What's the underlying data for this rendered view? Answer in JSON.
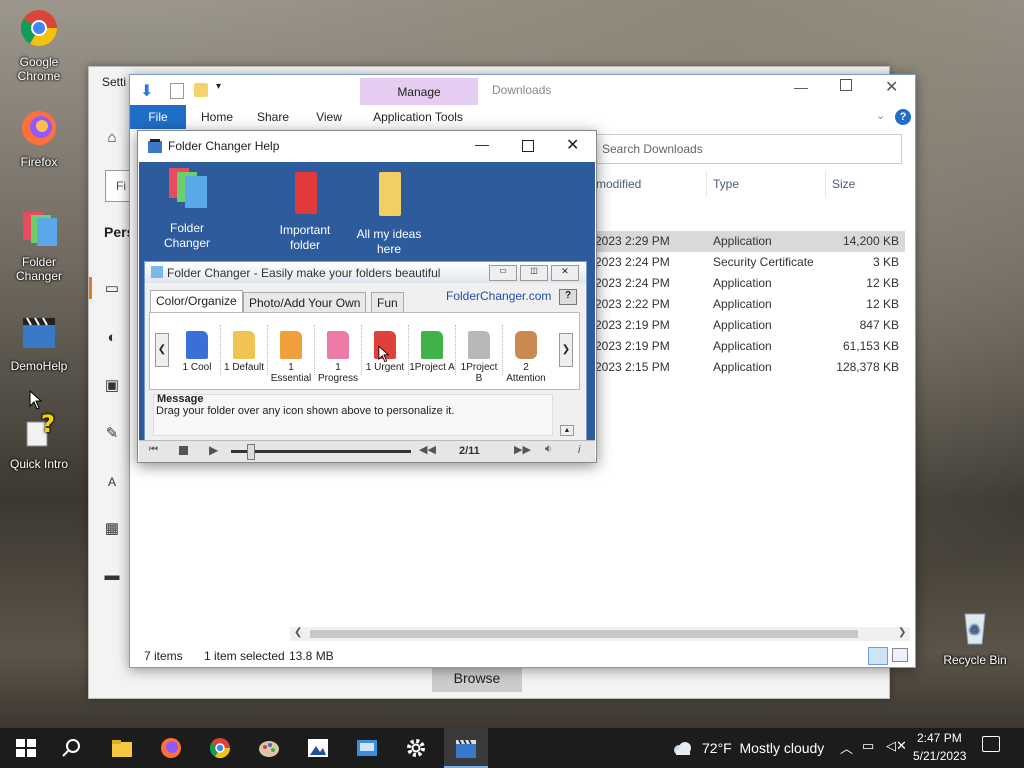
{
  "desktop": {
    "icons": [
      {
        "label": "Google Chrome"
      },
      {
        "label": "Firefox"
      },
      {
        "label": "Folder Changer"
      },
      {
        "label": "DemoHelp"
      },
      {
        "label": "Quick Intro"
      },
      {
        "label": "Recycle Bin"
      }
    ]
  },
  "settings": {
    "title": "Setti",
    "search_placeholder": "Fi",
    "section": "Pers",
    "browse_button": "Browse"
  },
  "explorer": {
    "title": "Downloads",
    "manage_tab": "Manage",
    "tabs": [
      "File",
      "Home",
      "Share",
      "View",
      "Application Tools"
    ],
    "search_placeholder": "Search Downloads",
    "columns": {
      "modified": "modified",
      "type": "Type",
      "size": "Size"
    },
    "files": [
      {
        "date": "2023 2:29 PM",
        "type": "Application",
        "size": "14,200 KB"
      },
      {
        "date": "2023 2:24 PM",
        "type": "Security Certificate",
        "size": "3 KB"
      },
      {
        "date": "2023 2:24 PM",
        "type": "Application",
        "size": "12 KB"
      },
      {
        "date": "2023 2:22 PM",
        "type": "Application",
        "size": "12 KB"
      },
      {
        "date": "2023 2:19 PM",
        "type": "Application",
        "size": "847 KB"
      },
      {
        "date": "2023 2:19 PM",
        "type": "Application",
        "size": "61,153 KB"
      },
      {
        "date": "2023 2:15 PM",
        "type": "Application",
        "size": "128,378 KB"
      }
    ],
    "status": {
      "items": "7 items",
      "selected": "1 item selected",
      "size": "13.8 MB"
    }
  },
  "help_window": {
    "title": "Folder Changer Help",
    "icons": [
      {
        "label": "Folder Changer"
      },
      {
        "label": "Important folder"
      },
      {
        "label": "All my ideas here"
      }
    ],
    "inner_title": "Folder Changer - Easily make your folders beautiful",
    "tabs": [
      "Color/Organize",
      "Photo/Add Your Own",
      "Fun"
    ],
    "link": "FolderChanger.com",
    "help_btn": "?",
    "folders": [
      {
        "label": "1 Cool",
        "color": "#3a6fd8"
      },
      {
        "label": "1 Default",
        "color": "#f0c452"
      },
      {
        "label": "1 Essential",
        "color": "#f0a03a"
      },
      {
        "label": "1 Progress",
        "color": "#ee7aa8"
      },
      {
        "label": "1 Urgent",
        "color": "#e0403a"
      },
      {
        "label": "1Project A",
        "color": "#3fb24a"
      },
      {
        "label": "1Project B",
        "color": "#b8b8b8"
      },
      {
        "label": "2 Attention",
        "color": "#c88a50"
      }
    ],
    "message_title": "Message",
    "message_text": "Drag your folder over any icon shown above to personalize it.",
    "player_counter": "2/11"
  },
  "taskbar": {
    "weather": "72°F  Mostly cloudy",
    "time": "2:47 PM",
    "date": "5/21/2023"
  }
}
